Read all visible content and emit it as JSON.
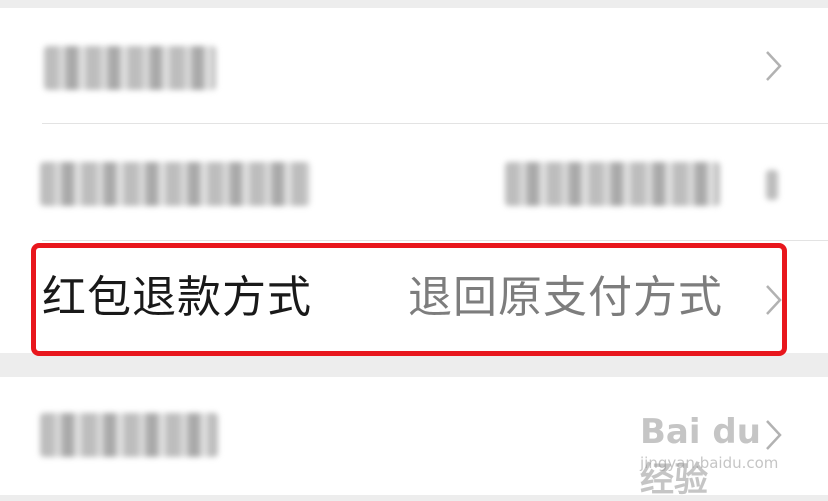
{
  "rows": [
    {
      "label": "",
      "value": "",
      "blurred": true
    },
    {
      "label": "",
      "value": "",
      "blurred": true
    },
    {
      "label": "红包退款方式",
      "value": "退回原支付方式",
      "blurred": false
    },
    {
      "label": "",
      "value": "",
      "blurred": true
    }
  ],
  "highlight": {
    "color": "#e8171d"
  },
  "watermark": {
    "logo": "Bai du 经验",
    "sub": "jingyan.baidu.com"
  },
  "icons": {
    "chevron": "chevron-right-icon"
  }
}
